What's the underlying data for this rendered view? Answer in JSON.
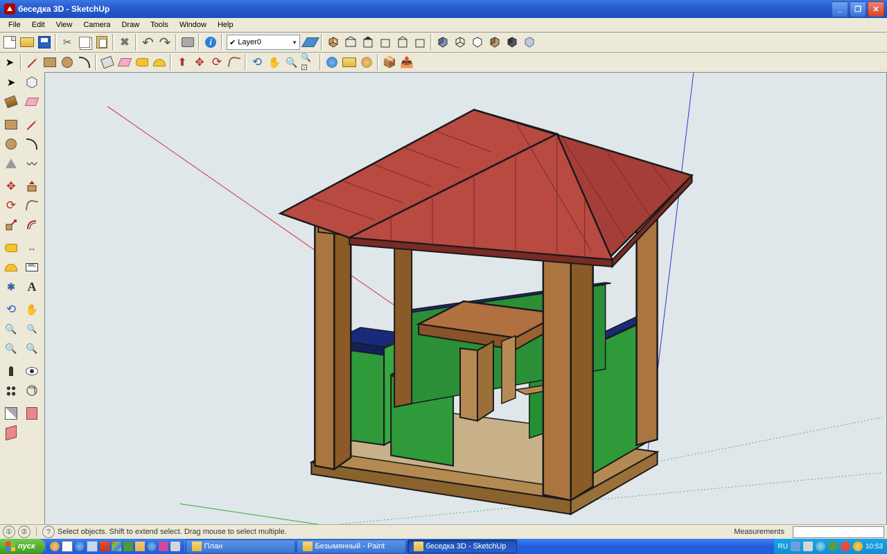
{
  "window": {
    "title": "беседка 3D - SketchUp"
  },
  "menu": {
    "file": "File",
    "edit": "Edit",
    "view": "View",
    "camera": "Camera",
    "draw": "Draw",
    "tools": "Tools",
    "window": "Window",
    "help": "Help"
  },
  "layer": {
    "name": "Layer0"
  },
  "status": {
    "hint": "Select objects. Shift to extend select. Drag mouse to select multiple.",
    "meas_label": "Measurements",
    "q1": "①",
    "q2": "②",
    "q3": "?"
  },
  "taskbar": {
    "start": "пуск",
    "tasks": [
      {
        "label": "План",
        "active": false
      },
      {
        "label": "Безымянный - Paint",
        "active": false
      },
      {
        "label": "беседка 3D - SketchUp",
        "active": true
      }
    ],
    "lang": "RU",
    "clock": "10:53"
  }
}
